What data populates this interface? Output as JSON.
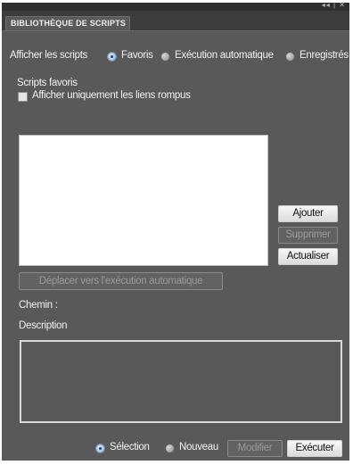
{
  "panel": {
    "title_controls": "◂◂ | ✕",
    "tab_label": "BIBLIOTHÈQUE DE SCRIPTS"
  },
  "show_scripts": {
    "label": "Afficher les scripts",
    "options": [
      {
        "label": "Favoris",
        "selected": true
      },
      {
        "label": "Exécution automatique",
        "selected": false
      },
      {
        "label": "Enregistrés",
        "selected": false
      }
    ]
  },
  "favorites": {
    "section_label": "Scripts favoris",
    "broken_links_checkbox": {
      "label": "Afficher uniquement les liens rompus",
      "checked": false
    }
  },
  "side_buttons": {
    "add": "Ajouter",
    "remove": "Supprimer",
    "refresh": "Actualiser"
  },
  "move_button": "Déplacer vers l'exécution automatique",
  "path_label": "Chemin :",
  "description_label": "Description",
  "footer": {
    "selection": {
      "label": "Sélection",
      "selected": true
    },
    "new": {
      "label": "Nouveau",
      "selected": false
    },
    "modify": "Modifier",
    "execute": "Exécuter"
  }
}
